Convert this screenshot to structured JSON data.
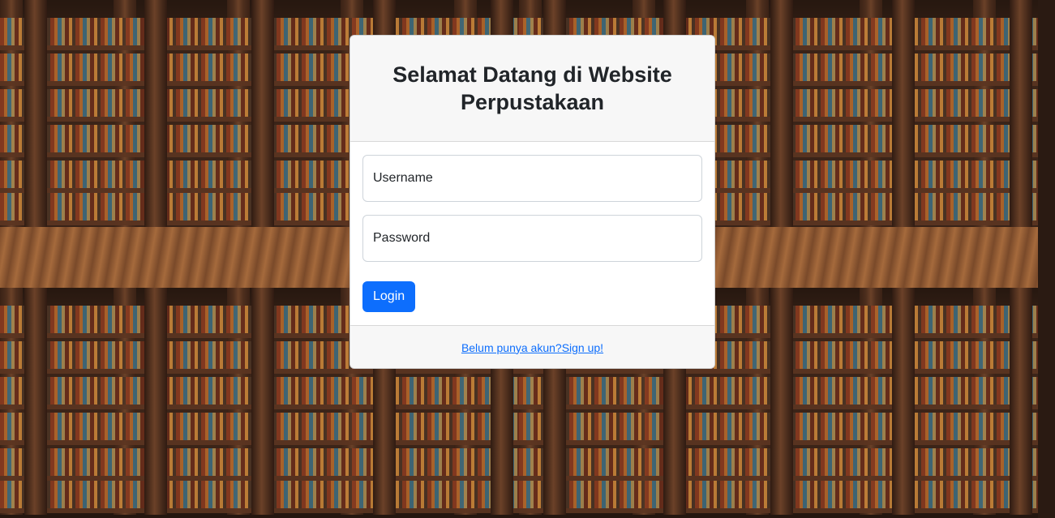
{
  "login": {
    "title": "Selamat Datang di Website Perpustakaan",
    "username_placeholder": "Username",
    "password_placeholder": "Password",
    "login_button": "Login",
    "signup_link": "Belum punya akun?Sign up!"
  },
  "colors": {
    "primary": "#0d6efd",
    "header_bg": "#f7f7f7",
    "text": "#212529"
  }
}
